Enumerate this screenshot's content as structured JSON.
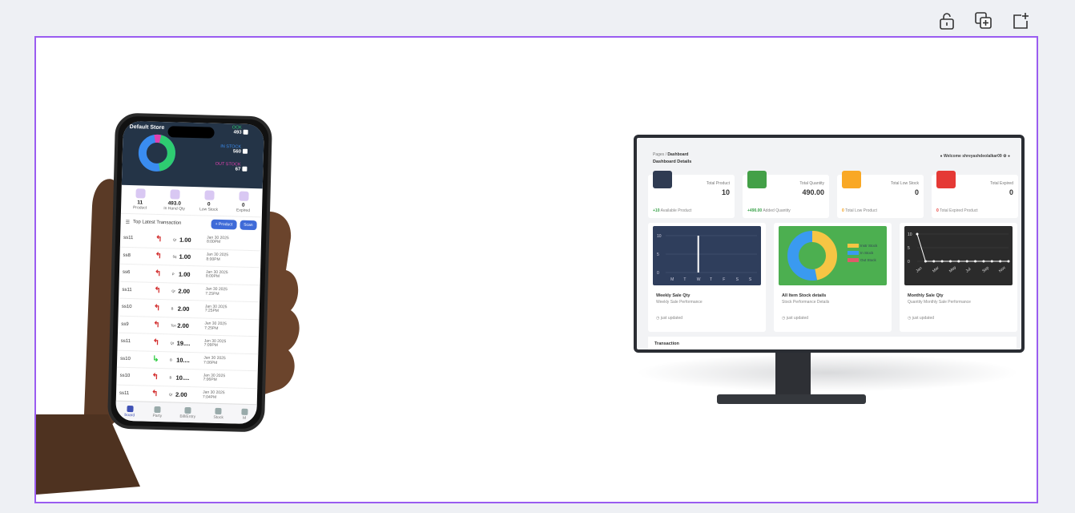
{
  "toolbar": {
    "icons": [
      "unlock-icon",
      "duplicate-icon",
      "add-frame-icon"
    ]
  },
  "phone": {
    "store_title": "Default Store",
    "legend": [
      {
        "label": "OCK",
        "value": "493",
        "color": "#2ecc71"
      },
      {
        "label": "IN STOCK",
        "value": "560",
        "color": "#3a8cf0"
      },
      {
        "label": "OUT STOCK",
        "value": "67",
        "color": "#e040b0"
      }
    ],
    "stats": [
      {
        "value": "11",
        "label": "Product"
      },
      {
        "value": "493.0",
        "label": "In Hand Qty"
      },
      {
        "value": "0",
        "label": "Low Stock"
      },
      {
        "value": "0",
        "label": "Expired"
      }
    ],
    "section_title": "Top Latest Transaction",
    "add_product": "+ Product",
    "scan": "Scan",
    "rows": [
      {
        "name": "ss11",
        "dir": "up",
        "sm": "Qr",
        "qty": "1.00",
        "date": "Jan 30 2025",
        "time": "8:00PM"
      },
      {
        "name": "ss8",
        "dir": "up",
        "sm": "Sq",
        "qty": "1.00",
        "date": "Jan 30 2025",
        "time": "8:00PM"
      },
      {
        "name": "ss6",
        "dir": "up",
        "sm": "P",
        "qty": "1.00",
        "date": "Jan 30 2025",
        "time": "8:00PM"
      },
      {
        "name": "ss11",
        "dir": "up",
        "sm": "Qr",
        "qty": "2.00",
        "date": "Jan 30 2025",
        "time": "7:25PM"
      },
      {
        "name": "ss10",
        "dir": "up",
        "sm": "B",
        "qty": "2.00",
        "date": "Jan 30 2025",
        "time": "7:25PM"
      },
      {
        "name": "ss9",
        "dir": "up",
        "sm": "Ton",
        "qty": "2.00",
        "date": "Jan 30 2025",
        "time": "7:25PM"
      },
      {
        "name": "ss11",
        "dir": "up",
        "sm": "Qr",
        "qty": "19....",
        "date": "Jan 30 2025",
        "time": "7:09PM"
      },
      {
        "name": "ss10",
        "dir": "down",
        "sm": "B",
        "qty": "10....",
        "date": "Jan 30 2025",
        "time": "7:06PM"
      },
      {
        "name": "ss10",
        "dir": "up",
        "sm": "B",
        "qty": "10....",
        "date": "Jan 30 2025",
        "time": "7:06PM"
      },
      {
        "name": "ss11",
        "dir": "up",
        "sm": "Qr",
        "qty": "2.00",
        "date": "Jan 30 2025",
        "time": "7:04PM"
      }
    ],
    "nav": [
      "board",
      "Party",
      "Bill/Entry",
      "Stock",
      "M"
    ]
  },
  "monitor": {
    "crumb_pages": "Pages",
    "crumb_sep": "/",
    "crumb_current": "Dashboard",
    "title": "Dashboard Details",
    "welcome": "Welcome shreyashdeolalkar09",
    "cards": [
      {
        "label": "Total Product",
        "value": "10",
        "foot_bold": "+10",
        "foot": "Available Product",
        "color": "#2f3b52",
        "foot_color": "#3aa24a"
      },
      {
        "label": "Total Quantity",
        "value": "490.00",
        "foot_bold": "+490.00",
        "foot": "Added Quantity",
        "color": "#43a047",
        "foot_color": "#3aa24a"
      },
      {
        "label": "Total Low Stock",
        "value": "0",
        "foot_bold": "0",
        "foot": "Total Low Product",
        "color": "#f9a825",
        "foot_color": "#f39c12"
      },
      {
        "label": "Total Expired",
        "value": "0",
        "foot_bold": "0",
        "foot": "Total Expired Product",
        "color": "#e53935",
        "foot_color": "#e53935"
      }
    ],
    "graphs": [
      {
        "title": "Weekly Sale Qty",
        "sub": "Weekly Sale Performance",
        "updated": "just updated"
      },
      {
        "title": "All Item Stock details",
        "sub": "Stock Performance Details",
        "updated": "just updated"
      },
      {
        "title": "Monthly Sale Qty",
        "sub": "Quantity Monthly Sale Performance",
        "updated": "just updated"
      }
    ],
    "transaction": "Transaction"
  },
  "chart_data": [
    {
      "type": "bar",
      "categories": [
        "M",
        "T",
        "W",
        "T",
        "F",
        "S",
        "S"
      ],
      "values": [
        0,
        0,
        10,
        0,
        0,
        0,
        0
      ],
      "ylim": [
        0,
        10
      ],
      "yticks": [
        "10",
        "5",
        "0"
      ]
    },
    {
      "type": "pie",
      "series": [
        {
          "name": "Instr Stock",
          "value": 493,
          "color": "#f6c544"
        },
        {
          "name": "In Stock",
          "value": 560,
          "color": "#3a9af0"
        },
        {
          "name": "Out Stock",
          "value": 0,
          "color": "#e05a6a"
        }
      ]
    },
    {
      "type": "line",
      "categories": [
        "Jan",
        "Mar",
        "May",
        "Jul",
        "Sep",
        "Nov"
      ],
      "values": [
        10,
        0,
        0,
        0,
        0,
        0,
        0,
        0,
        0,
        0,
        0,
        0
      ],
      "ylim": [
        0,
        10
      ],
      "yticks": [
        "10",
        "5",
        "0"
      ]
    }
  ]
}
